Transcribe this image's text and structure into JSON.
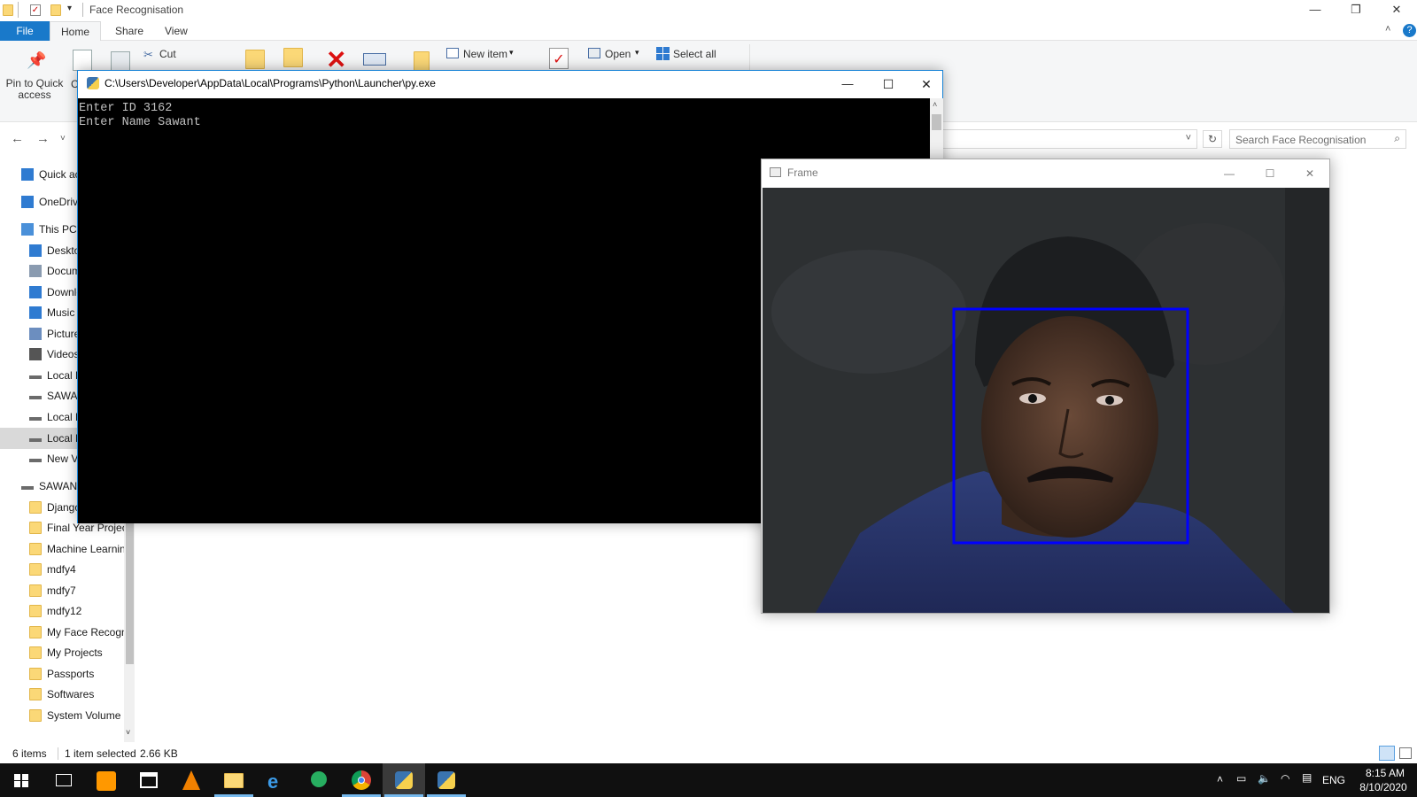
{
  "explorer": {
    "title": "Face Recognisation",
    "tabs": {
      "file": "File",
      "home": "Home",
      "share": "Share",
      "view": "View"
    },
    "ribbon": {
      "pin_to_quick_access": "Pin to Quick access",
      "copy_partial": "C",
      "cut": "Cut",
      "new_item": "New item",
      "open": "Open",
      "select_all": "Select all"
    },
    "search_placeholder": "Search Face Recognisation",
    "nav": [
      {
        "label": "Quick access",
        "icon": "star-icon"
      },
      {
        "label": "OneDrive",
        "icon": "cloud-icon"
      },
      {
        "label": "This PC",
        "icon": "computer-icon"
      },
      {
        "label": "Desktop",
        "icon": "desktop-icon"
      },
      {
        "label": "Documents",
        "icon": "document-icon"
      },
      {
        "label": "Downloads",
        "icon": "download-icon"
      },
      {
        "label": "Music",
        "icon": "music-icon"
      },
      {
        "label": "Pictures",
        "icon": "pictures-icon"
      },
      {
        "label": "Videos",
        "icon": "videos-icon"
      },
      {
        "label": "Local Disk",
        "icon": "drive-icon"
      },
      {
        "label": "SAWANT",
        "icon": "drive-icon"
      },
      {
        "label": "Local Disk",
        "icon": "drive-icon"
      },
      {
        "label": "Local Disk",
        "icon": "drive-icon"
      },
      {
        "label": "New Volume",
        "icon": "drive-icon"
      },
      {
        "label": "SAWANT",
        "icon": "drive-icon"
      },
      {
        "label": "Django",
        "icon": "folder-icon"
      },
      {
        "label": "Final Year Project",
        "icon": "folder-icon"
      },
      {
        "label": "Machine Learning",
        "icon": "folder-icon"
      },
      {
        "label": "mdfy4",
        "icon": "folder-icon"
      },
      {
        "label": "mdfy7",
        "icon": "folder-icon"
      },
      {
        "label": "mdfy12",
        "icon": "folder-icon"
      },
      {
        "label": "My Face Recognition",
        "icon": "folder-icon"
      },
      {
        "label": "My Projects",
        "icon": "folder-icon"
      },
      {
        "label": "Passports",
        "icon": "folder-icon"
      },
      {
        "label": "Softwares",
        "icon": "folder-icon"
      },
      {
        "label": "System Volume Information",
        "icon": "folder-icon"
      }
    ],
    "status": {
      "items": "6 items",
      "selected": "1 item selected",
      "size": "2.66 KB"
    }
  },
  "console": {
    "title": "C:\\Users\\Developer\\AppData\\Local\\Programs\\Python\\Launcher\\py.exe",
    "lines": [
      "Enter ID 3162",
      "Enter Name Sawant"
    ]
  },
  "frame": {
    "title": "Frame",
    "face_box_color": "#0000ff"
  },
  "taskbar": {
    "lang": "ENG",
    "time": "8:15 AM",
    "date": "8/10/2020"
  },
  "colors": {
    "accent": "#1979ca",
    "console_bg": "#000000",
    "taskbar_bg": "#101010"
  }
}
